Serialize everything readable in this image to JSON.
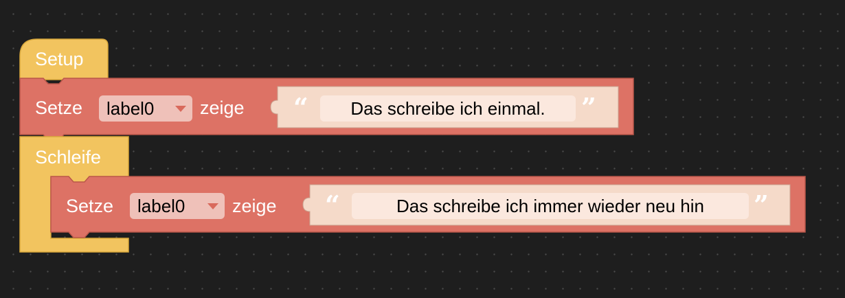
{
  "colors": {
    "background": "#1e1e1e",
    "event_block": "#f2c45f",
    "set_block": "#dd7265",
    "text_block": "#f5dac9",
    "text_field": "#fbe8de",
    "dropdown_field": "#efc1b9"
  },
  "setup_block": {
    "label": "Setup",
    "statement": {
      "set_label": "Setze",
      "target_dropdown": "label0",
      "show_label": "zeige",
      "text_value": "Das schreibe ich einmal.",
      "open_quote": "“",
      "close_quote": "”"
    }
  },
  "loop_block": {
    "label": "Schleife",
    "statement": {
      "set_label": "Setze",
      "target_dropdown": "label0",
      "show_label": "zeige",
      "text_value": "Das schreibe ich immer wieder neu hin",
      "open_quote": "“",
      "close_quote": "”"
    }
  },
  "icons": {
    "dropdown_arrow": "chevron-down-icon"
  }
}
